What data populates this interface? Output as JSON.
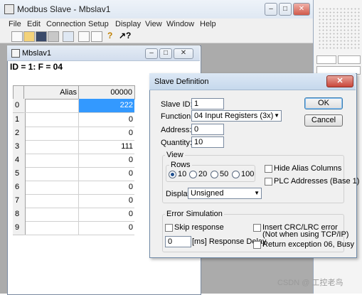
{
  "app": {
    "title": "Modbus Slave - Mbslav1",
    "menu": [
      "File",
      "Edit",
      "Connection",
      "Setup",
      "Display",
      "View",
      "Window",
      "Help"
    ]
  },
  "child": {
    "title": "Mbslav1",
    "info": "ID = 1: F = 04",
    "grid": {
      "headers": [
        "Alias",
        "00000"
      ],
      "rows": [
        {
          "num": "0",
          "value": "222"
        },
        {
          "num": "1",
          "value": "0"
        },
        {
          "num": "2",
          "value": "0"
        },
        {
          "num": "3",
          "value": "111"
        },
        {
          "num": "4",
          "value": "0"
        },
        {
          "num": "5",
          "value": "0"
        },
        {
          "num": "6",
          "value": "0"
        },
        {
          "num": "7",
          "value": "0"
        },
        {
          "num": "8",
          "value": "0"
        },
        {
          "num": "9",
          "value": "0"
        }
      ]
    }
  },
  "dialog": {
    "title": "Slave Definition",
    "slave_id_label": "Slave ID:",
    "slave_id_value": "1",
    "function_label": "Function:",
    "function_value": "04 Input Registers (3x)",
    "address_label": "Address:",
    "address_value": "0",
    "quantity_label": "Quantity:",
    "quantity_value": "10",
    "ok": "OK",
    "cancel": "Cancel",
    "view_group": "View",
    "rows_group": "Rows",
    "row_options": [
      "10",
      "20",
      "50",
      "100"
    ],
    "hide_alias": "Hide Alias Columns",
    "plc_addresses": "PLC Addresses (Base 1)",
    "display_label": "Display:",
    "display_value": "Unsigned",
    "error_group": "Error Simulation",
    "skip_response": "Skip response",
    "insert_crc": "Insert CRC/LRC error",
    "insert_crc_note": "(Not when using TCP/IP)",
    "response_delay_value": "0",
    "response_delay_label": "[ms] Response Delay",
    "return_exception": "Return exception 06, Busy"
  },
  "watermark": "CSDN @ 工控老鸟"
}
